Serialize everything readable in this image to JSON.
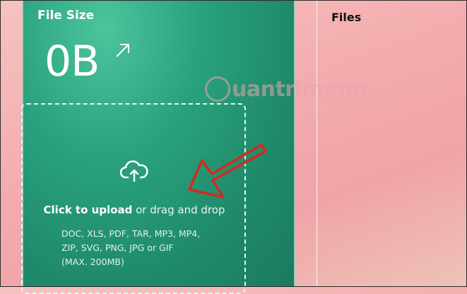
{
  "panel": {
    "title": "File Size",
    "size_value": "0B"
  },
  "dropzone": {
    "click_label": "Click to upload",
    "drag_label": " or drag and drop",
    "formats_line1": "DOC, XLS, PDF, TAR, MP3, MP4,",
    "formats_line2": "ZIP, SVG, PNG, JPG or GIF",
    "max_size": "(MAX. 200MB)"
  },
  "files": {
    "title": "Files"
  },
  "watermark": {
    "text": "uantrimang"
  },
  "colors": {
    "panel_green": "#1f8a6b",
    "annotation_red": "#d9281e",
    "background_pink": "#f3abad"
  }
}
